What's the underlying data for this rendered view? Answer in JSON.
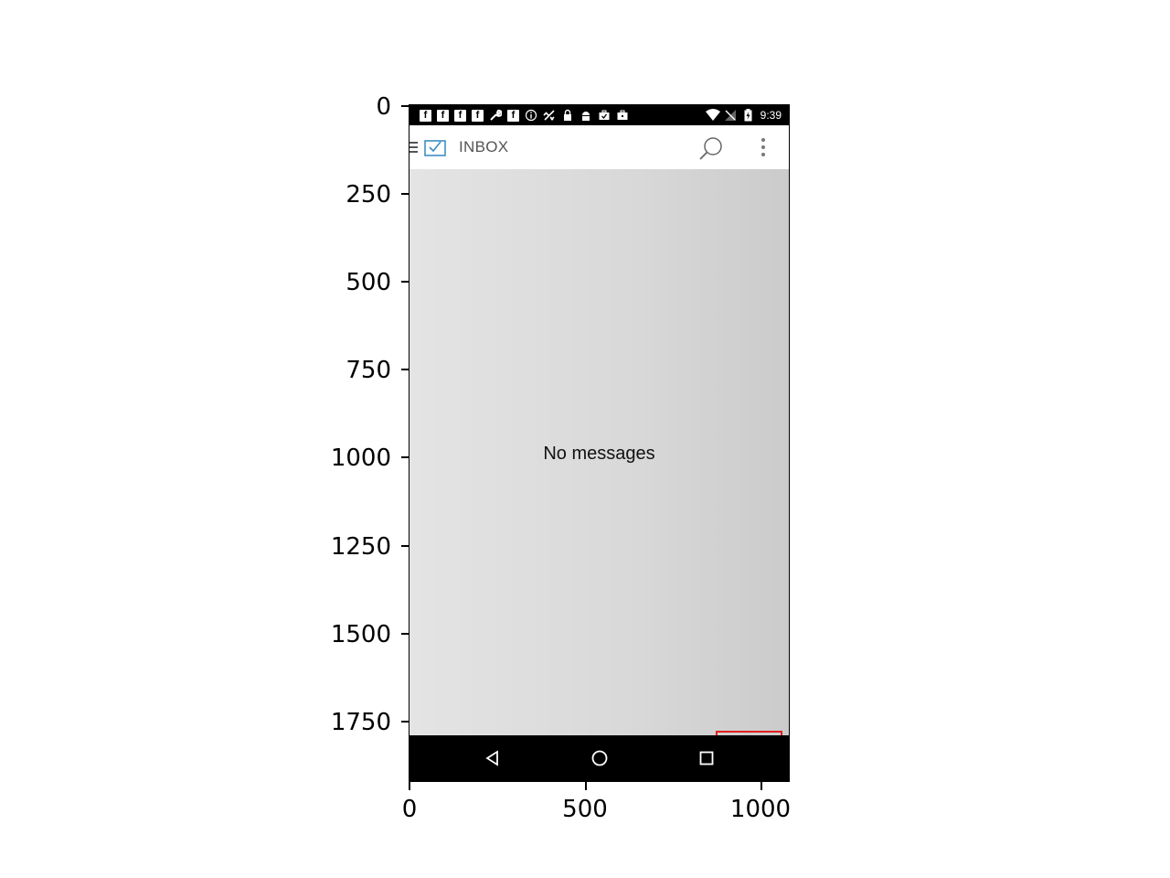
{
  "axes": {
    "y_ticks": [
      "0",
      "250",
      "500",
      "750",
      "1000",
      "1250",
      "1500",
      "1750"
    ],
    "x_ticks": [
      "0",
      "500",
      "1000"
    ]
  },
  "statusbar": {
    "time": "9:39",
    "icons": [
      "facebook-icon",
      "facebook-icon",
      "facebook-icon",
      "facebook-icon",
      "wrench-icon",
      "facebook-icon",
      "info-icon",
      "satellite-icon",
      "lock-icon",
      "android-icon",
      "briefcase-check-icon",
      "briefcase-icon"
    ],
    "right_icons": [
      "wifi-icon",
      "no-signal-icon",
      "battery-charging-icon"
    ]
  },
  "appbar": {
    "title": "INBOX",
    "icons": [
      "menu-icon",
      "mail-icon",
      "search-icon",
      "overflow-menu-icon"
    ]
  },
  "content": {
    "empty_message": "No messages"
  },
  "fab": {
    "icon": "compose-pen-icon",
    "color": "#6fa8d6"
  },
  "highlight": {
    "color": "#e02020"
  },
  "navbar": {
    "icons": [
      "back-icon",
      "home-icon",
      "recents-icon"
    ]
  }
}
